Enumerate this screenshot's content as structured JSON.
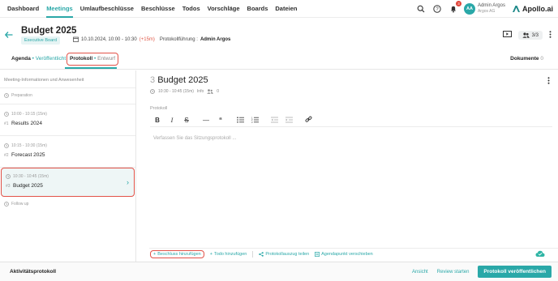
{
  "nav": {
    "items": [
      {
        "label": "Dashboard",
        "active": false
      },
      {
        "label": "Meetings",
        "active": true
      },
      {
        "label": "Umlaufbeschlüsse",
        "active": false
      },
      {
        "label": "Beschlüsse",
        "active": false
      },
      {
        "label": "Todos",
        "active": false
      },
      {
        "label": "Vorschläge",
        "active": false
      },
      {
        "label": "Boards",
        "active": false
      },
      {
        "label": "Dateien",
        "active": false
      }
    ],
    "notification_count": "3",
    "user": {
      "initials": "AA",
      "name": "Admin Argos",
      "org": "Argos AG"
    },
    "logo_text": "Apollo.ai"
  },
  "meeting": {
    "title": "Budget 2025",
    "board": "Executive Board",
    "date": "10.10.2024, 10:00 - 10:30",
    "overrun": "(+15m)",
    "protokoll_label": "Protokollführung :",
    "protokoll_by": "Admin Argos",
    "participants": "3/3"
  },
  "tabs": {
    "agenda": {
      "label": "Agenda",
      "bullet": "•",
      "state": "Veröffentlicht"
    },
    "protokoll": {
      "label": "Protokoll",
      "bullet": "•",
      "state": "Entwurf"
    },
    "dokumente": {
      "label": "Dokumente",
      "count": "0"
    }
  },
  "sidebar": {
    "header": "Meeting-Informationen und Anwesenheit",
    "preparation": "Preparation",
    "items": [
      {
        "time": "10:00 - 10:15 (15m)",
        "num": "#1",
        "title": "Results 2024"
      },
      {
        "time": "10:15 - 10:30 (15m)",
        "num": "#2",
        "title": "Forecast 2025"
      },
      {
        "time": "10:30 - 10:45 (15m)",
        "num": "#3",
        "title": "Budget 2025"
      }
    ],
    "followup": "Follow up"
  },
  "main": {
    "item_number": "3",
    "item_title": "Budget 2025",
    "time": "10:30 - 10:45 (15m)",
    "info": "Info",
    "people_count": "0",
    "protokoll_label": "Protokoll",
    "placeholder": "Verfassen Sie das Sitzungsprotokoll ..."
  },
  "actions": {
    "beschluss": "Beschluss hinzufügen",
    "todo": "Todo hinzufügen",
    "share": "Protokollauszug teilen",
    "move": "Agendapunkt verschieben"
  },
  "footer": {
    "title": "Aktivitätsprotokoll",
    "ansicht": "Ansicht",
    "review": "Review starten",
    "publish": "Protokoll veröffentlichen"
  }
}
